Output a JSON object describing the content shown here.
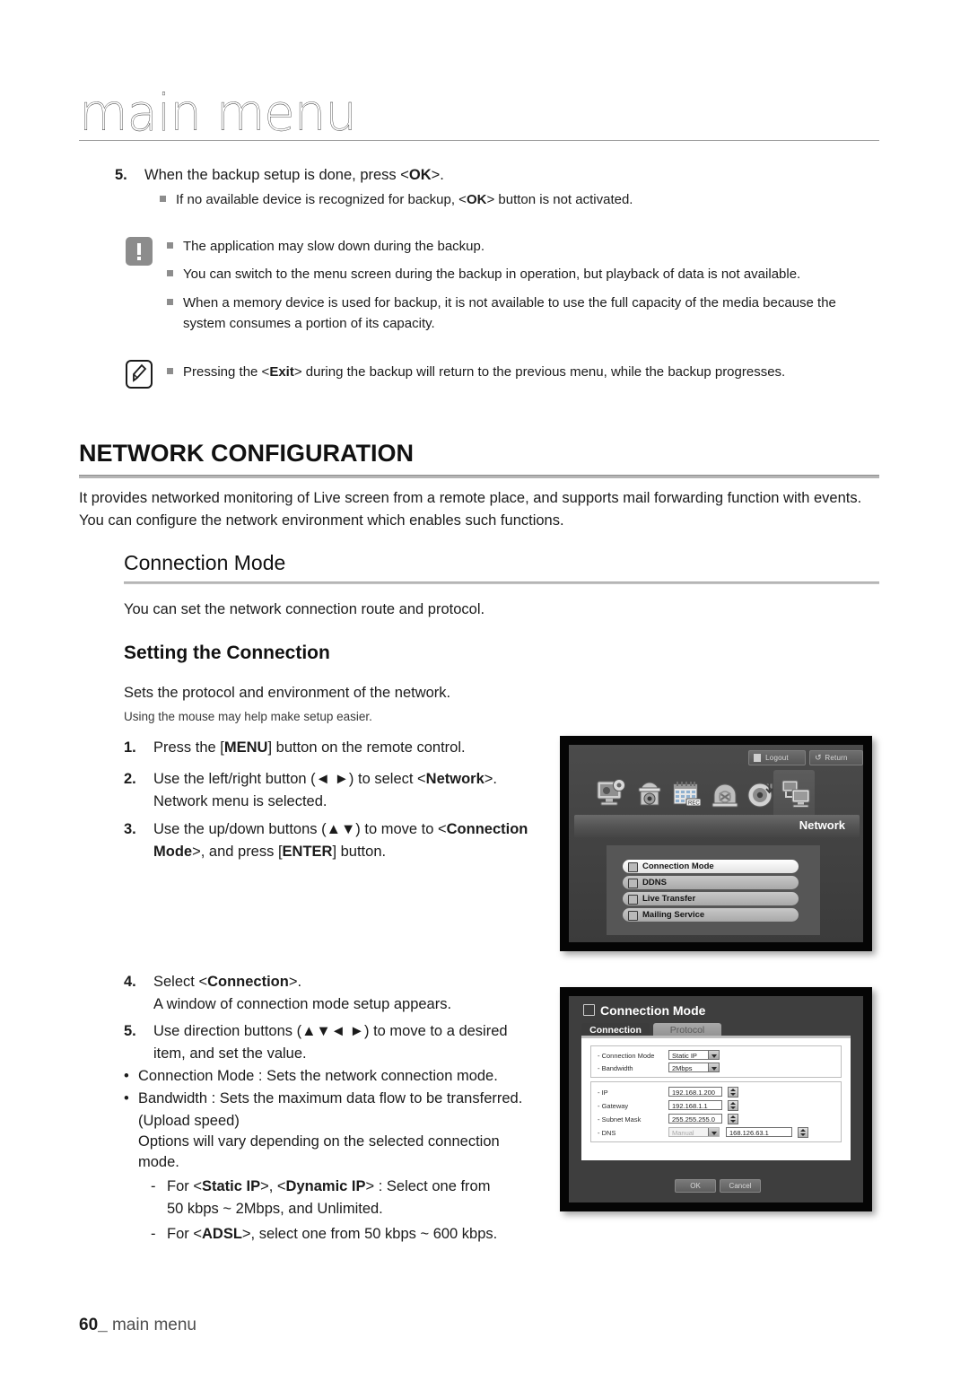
{
  "header": {
    "title": "main menu"
  },
  "top_steps": [
    {
      "number": "5.",
      "text_html": "When the backup setup is done, press <b>&lt;OK&gt;</b>."
    }
  ],
  "top_sub_bullets": [
    "If no available device is recognized for backup, <OK> button is not activated."
  ],
  "caution_box": {
    "icon": "caution-icon",
    "bullets": [
      "The application may slow down during the backup.",
      "You can switch to the menu screen during the backup in operation, but playback of data is not available.",
      "When a memory device is used for backup, it is not available to use the full capacity of the media because the system consumes a portion of its capacity."
    ]
  },
  "note_box": {
    "icon": "note-pencil-icon",
    "bullets": [
      "Pressing the <Exit> during the backup will return to the previous menu, while the backup progresses."
    ]
  },
  "section": {
    "heading": "NETWORK CONFIGURATION",
    "intro": "It provides networked monitoring of Live screen from a remote place, and supports mail forwarding function with events. You can configure the network environment which enables such functions.",
    "subheading": "Connection Mode",
    "sub_intro": "You can set the network connection route and protocol.",
    "subheading2": "Setting the Connection",
    "sub2_intro": "Sets the protocol and environment of the network.",
    "sub2_note": "Using the mouse may help make setup easier."
  },
  "steps": [
    {
      "number": "1.",
      "line1": "Press the [MENU] button on the remote control.",
      "line2": ""
    },
    {
      "number": "2.",
      "line1": "Use the left/right button (◄ ►) to select <Network>.",
      "line2": "Network menu is selected."
    },
    {
      "number": "3.",
      "line1": "Use the up/down buttons (▲▼) to move to <Connection",
      "line2": "Mode>, and press [ENTER] button."
    },
    {
      "number": "4.",
      "line1": "Select <Connection>.",
      "line2": "A window of connection mode setup appears."
    },
    {
      "number": "5.",
      "line1": "Use direction buttons (▲▼◄ ►) to move to a desired",
      "line2": "item, and set the value."
    }
  ],
  "dot_items": [
    {
      "bullet": "•",
      "text": "Connection Mode : Sets the network connection mode."
    },
    {
      "bullet": "•",
      "text": "Bandwidth : Sets the maximum data flow to be transferred."
    }
  ],
  "bandwidth_extra": [
    "(Upload speed)",
    "Options will vary depending on the selected connection",
    "mode."
  ],
  "dash_items": [
    {
      "dash": "-",
      "line1": "For <Static IP>, <Dynamic IP> : Select one from",
      "line2": "50 kbps ~ 2Mbps, and Unlimited."
    },
    {
      "dash": "-",
      "line1": "For <ADSL>, select one from 50 kbps ~ 600 kbps.",
      "line2": ""
    }
  ],
  "screenshot_network": {
    "buttons": [
      {
        "label": "Logout",
        "icon": "logout-icon"
      },
      {
        "label": "Return",
        "icon": "return-arrow-icon"
      }
    ],
    "tab_icons": [
      "system-monitor-gear-icon",
      "dome-camera-icon",
      "calendar-rec-icon",
      "dome-speaker-icon",
      "disc-backup-icon",
      "network-monitors-icon"
    ],
    "active_tab_label": "Network",
    "menu_items": [
      {
        "label": "Connection Mode",
        "icon": "connection-icon",
        "selected": true
      },
      {
        "label": "DDNS",
        "icon": "ddns-icon",
        "selected": false
      },
      {
        "label": "Live Transfer",
        "icon": "live-transfer-icon",
        "selected": false
      },
      {
        "label": "Mailing Service",
        "icon": "mail-icon",
        "selected": false
      }
    ]
  },
  "screenshot_dialog": {
    "title": "Connection Mode",
    "title_icon": "connection-icon",
    "tabs": [
      {
        "label": "Connection",
        "active": true
      },
      {
        "label": "Protocol",
        "active": false
      }
    ],
    "group1": [
      {
        "label": "- Connection Mode",
        "value": "Static IP",
        "control": "dropdown"
      },
      {
        "label": "- Bandwidth",
        "value": "2Mbps",
        "control": "dropdown"
      }
    ],
    "group2": [
      {
        "label": "- IP",
        "value": "192.168.1.200",
        "control": "spinner"
      },
      {
        "label": "- Gateway",
        "value": "192.168.1.1",
        "control": "spinner"
      },
      {
        "label": "- Subnet Mask",
        "value": "255.255.255.0",
        "control": "spinner"
      },
      {
        "label": "- DNS",
        "value": "Manual",
        "value2": "168.126.63.1",
        "control": "dropdown-spinner",
        "dimmed": true
      }
    ],
    "footer_buttons": [
      {
        "label": "OK"
      },
      {
        "label": "Cancel"
      }
    ]
  },
  "footer": {
    "page": "60_",
    "label": "main menu"
  }
}
